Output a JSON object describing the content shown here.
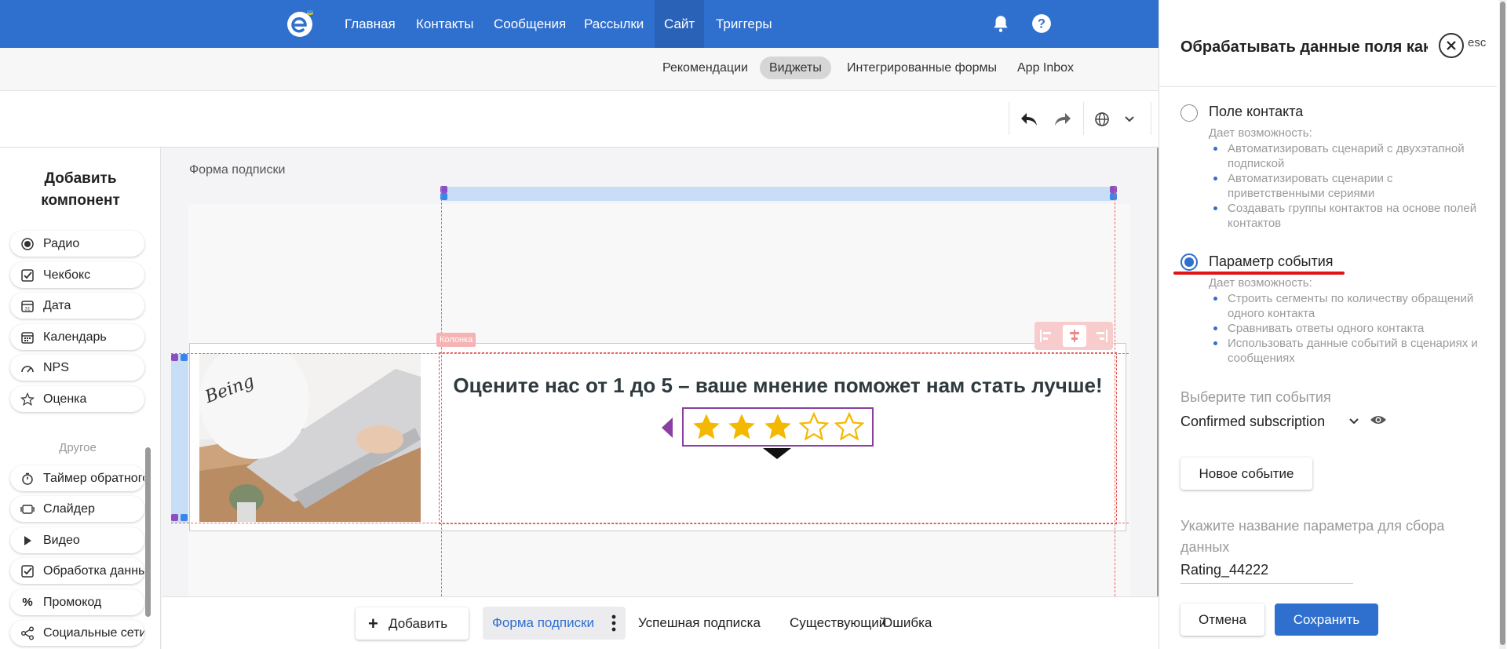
{
  "nav": {
    "items": [
      "Главная",
      "Контакты",
      "Сообщения",
      "Рассылки",
      "Сайт",
      "Триггеры"
    ],
    "active": "Сайт"
  },
  "subnav": {
    "items": [
      "Рекомендации",
      "Виджеты",
      "Интегрированные формы",
      "App Inbox"
    ],
    "active": "Виджеты"
  },
  "sidebar": {
    "title": "Добавить компонент",
    "components": [
      {
        "label": "Радио",
        "icon": "radio-icon"
      },
      {
        "label": "Чекбокс",
        "icon": "checkbox-icon"
      },
      {
        "label": "Дата",
        "icon": "date-icon"
      },
      {
        "label": "Календарь",
        "icon": "calendar-icon"
      },
      {
        "label": "NPS",
        "icon": "nps-gauge-icon"
      },
      {
        "label": "Оценка",
        "icon": "star-icon"
      }
    ],
    "other_title": "Другое",
    "other": [
      {
        "label": "Таймер обратного",
        "icon": "timer-icon"
      },
      {
        "label": "Слайдер",
        "icon": "slider-icon"
      },
      {
        "label": "Видео",
        "icon": "play-icon"
      },
      {
        "label": "Обработка данных",
        "icon": "checkbox-icon"
      },
      {
        "label": "Промокод",
        "icon": "percent-icon"
      },
      {
        "label": "Социальные сети",
        "icon": "share-icon"
      }
    ]
  },
  "canvas": {
    "label": "Форма подписки",
    "column_tag": "Колонка",
    "headline": "Оцените нас от 1 до 5 – ваше мнение поможет нам стать лучше!",
    "rating": {
      "value": 3,
      "max": 5
    }
  },
  "bottom": {
    "add_label": "Добавить",
    "tabs": [
      "Форма подписки",
      "Успешная подписка",
      "Существующий",
      "Ошибка"
    ],
    "active": "Форма подписки"
  },
  "panel": {
    "title": "Обрабатывать данные поля как",
    "esc_label": "esc",
    "option1": {
      "label": "Поле контакта",
      "sub": "Дает возможность:",
      "bullets": [
        "Автоматизировать сценарий с двухэтапной подпиской",
        "Автоматизировать сценарии с приветственными сериями",
        "Создавать группы контактов на основе полей контактов"
      ]
    },
    "option2": {
      "label": "Параметр события",
      "sub": "Дает возможность:",
      "bullets": [
        "Строить сегменты по количеству обращений одного контакта",
        "Сравнивать ответы одного контакта",
        "Использовать данные событий в сценариях и сообщениях"
      ]
    },
    "selected": "option2",
    "event_type_label": "Выберите тип события",
    "event_type_value": "Confirmed subscription",
    "new_event_label": "Новое событие",
    "param_label": "Укажите название параметра для сбора данных",
    "param_value": "Rating_44222",
    "cancel_label": "Отмена",
    "save_label": "Сохранить"
  },
  "colors": {
    "brand": "#2f6fcd",
    "accent_red": "#e01414",
    "star": "#f5b800",
    "selection_purple": "#8b3fa3"
  }
}
